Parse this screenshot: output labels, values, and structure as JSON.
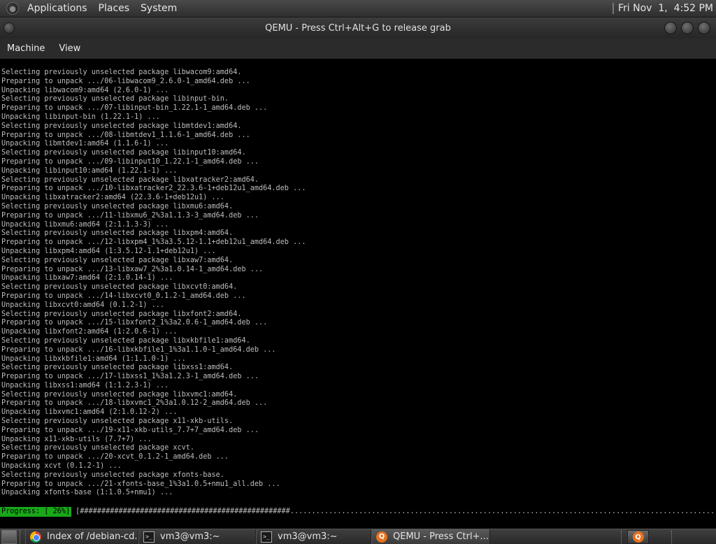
{
  "top_panel": {
    "menus": [
      "Applications",
      "Places",
      "System"
    ],
    "clock": "Fri Nov  1,  4:52 PM"
  },
  "window": {
    "title": "QEMU - Press Ctrl+Alt+G to release grab"
  },
  "menubar": {
    "items": [
      "Machine",
      "View"
    ]
  },
  "console": {
    "lines": [
      "Selecting previously unselected package libwacom9:amd64.",
      "Preparing to unpack .../06-libwacom9_2.6.0-1_amd64.deb ...",
      "Unpacking libwacom9:amd64 (2.6.0-1) ...",
      "Selecting previously unselected package libinput-bin.",
      "Preparing to unpack .../07-libinput-bin_1.22.1-1_amd64.deb ...",
      "Unpacking libinput-bin (1.22.1-1) ...",
      "Selecting previously unselected package libmtdev1:amd64.",
      "Preparing to unpack .../08-libmtdev1_1.1.6-1_amd64.deb ...",
      "Unpacking libmtdev1:amd64 (1.1.6-1) ...",
      "Selecting previously unselected package libinput10:amd64.",
      "Preparing to unpack .../09-libinput10_1.22.1-1_amd64.deb ...",
      "Unpacking libinput10:amd64 (1.22.1-1) ...",
      "Selecting previously unselected package libxatracker2:amd64.",
      "Preparing to unpack .../10-libxatracker2_22.3.6-1+deb12u1_amd64.deb ...",
      "Unpacking libxatracker2:amd64 (22.3.6-1+deb12u1) ...",
      "Selecting previously unselected package libxmu6:amd64.",
      "Preparing to unpack .../11-libxmu6_2%3a1.1.3-3_amd64.deb ...",
      "Unpacking libxmu6:amd64 (2:1.1.3-3) ...",
      "Selecting previously unselected package libxpm4:amd64.",
      "Preparing to unpack .../12-libxpm4_1%3a3.5.12-1.1+deb12u1_amd64.deb ...",
      "Unpacking libxpm4:amd64 (1:3.5.12-1.1+deb12u1) ...",
      "Selecting previously unselected package libxaw7:amd64.",
      "Preparing to unpack .../13-libxaw7_2%3a1.0.14-1_amd64.deb ...",
      "Unpacking libxaw7:amd64 (2:1.0.14-1) ...",
      "Selecting previously unselected package libxcvt0:amd64.",
      "Preparing to unpack .../14-libxcvt0_0.1.2-1_amd64.deb ...",
      "Unpacking libxcvt0:amd64 (0.1.2-1) ...",
      "Selecting previously unselected package libxfont2:amd64.",
      "Preparing to unpack .../15-libxfont2_1%3a2.0.6-1_amd64.deb ...",
      "Unpacking libxfont2:amd64 (1:2.0.6-1) ...",
      "Selecting previously unselected package libxkbfile1:amd64.",
      "Preparing to unpack .../16-libxkbfile1_1%3a1.1.0-1_amd64.deb ...",
      "Unpacking libxkbfile1:amd64 (1:1.1.0-1) ...",
      "Selecting previously unselected package libxss1:amd64.",
      "Preparing to unpack .../17-libxss1_1%3a1.2.3-1_amd64.deb ...",
      "Unpacking libxss1:amd64 (1:1.2.3-1) ...",
      "Selecting previously unselected package libxvmc1:amd64.",
      "Preparing to unpack .../18-libxvmc1_2%3a1.0.12-2_amd64.deb ...",
      "Unpacking libxvmc1:amd64 (2:1.0.12-2) ...",
      "Selecting previously unselected package x11-xkb-utils.",
      "Preparing to unpack .../19-x11-xkb-utils_7.7+7_amd64.deb ...",
      "Unpacking x11-xkb-utils (7.7+7) ...",
      "Selecting previously unselected package xcvt.",
      "Preparing to unpack .../20-xcvt_0.1.2-1_amd64.deb ...",
      "Unpacking xcvt (0.1.2-1) ...",
      "Selecting previously unselected package xfonts-base.",
      "Preparing to unpack .../21-xfonts-base_1%3a1.0.5+nmu1_all.deb ...",
      "Unpacking xfonts-base (1:1.0.5+nmu1) ..."
    ],
    "progress": {
      "label": "Progress: [ 26%]",
      "bar": "[#################################################.............................................................................................................................]",
      "percent": 26
    }
  },
  "taskbar": {
    "tasks": [
      {
        "label": "Index of /debian-cd...",
        "icon": "chrome-icon",
        "active": false
      },
      {
        "label": "vm3@vm3:~",
        "icon": "terminal-icon",
        "active": false
      },
      {
        "label": "vm3@vm3:~",
        "icon": "terminal-icon",
        "active": false
      },
      {
        "label": "QEMU - Press Ctrl+...",
        "icon": "qemu-icon",
        "active": true
      }
    ]
  },
  "colors": {
    "progress_green": "#18a818",
    "console_text": "#bdbdbd"
  }
}
